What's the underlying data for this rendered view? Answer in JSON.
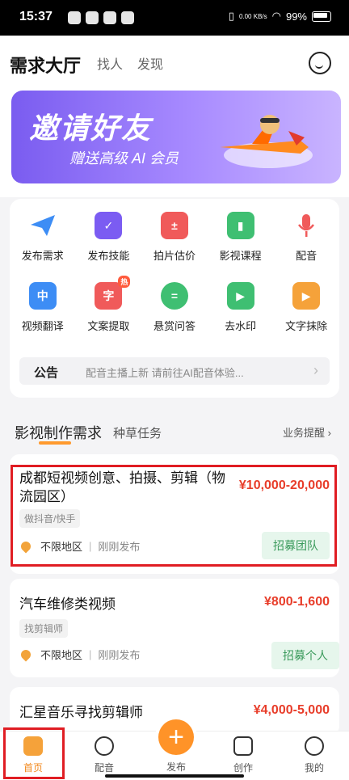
{
  "status": {
    "time": "15:37",
    "speed": "0.00\nKB/s",
    "battery": "99%"
  },
  "header": {
    "tabs": [
      "需求大厅",
      "找人",
      "发现"
    ]
  },
  "banner": {
    "title": "邀请好友",
    "subtitle": "赠送高级 AI 会员"
  },
  "menu": {
    "items": [
      {
        "label": "发布需求",
        "icon": "paper-plane-icon",
        "color": "#3d8df5"
      },
      {
        "label": "发布技能",
        "icon": "check-doc-icon",
        "color": "#7b5cf2"
      },
      {
        "label": "拍片估价",
        "icon": "calculator-icon",
        "color": "#f05a5a"
      },
      {
        "label": "影视课程",
        "icon": "bookmark-icon",
        "color": "#3fbf72"
      },
      {
        "label": "配音",
        "icon": "microphone-icon",
        "color": "#f05a5a"
      },
      {
        "label": "视频翻译",
        "icon": "translate-icon",
        "color": "#3d8df5",
        "glyph": "中"
      },
      {
        "label": "文案提取",
        "icon": "text-extract-icon",
        "color": "#f05a5a",
        "glyph": "字",
        "hot": "热"
      },
      {
        "label": "悬赏问答",
        "icon": "chat-bubble-icon",
        "color": "#3fbf72",
        "glyph": "="
      },
      {
        "label": "去水印",
        "icon": "watermark-icon",
        "color": "#3fbf72",
        "glyph": "▶"
      },
      {
        "label": "文字抹除",
        "icon": "erase-text-icon",
        "color": "#f5a23a",
        "glyph": "▶"
      }
    ],
    "notice_tag": "公告",
    "notice_text": "配音主播上新 请前往AI配音体验..."
  },
  "section": {
    "title": "影视制作需求",
    "sub": "种草任务",
    "right": "业务提醒"
  },
  "cards": [
    {
      "title": "成都短视频创意、拍摄、剪辑（物流园区）",
      "price": "¥10,000-20,000",
      "chip": "做抖音/快手",
      "location": "不限地区",
      "time": "刚刚发布",
      "badge": "招募团队"
    },
    {
      "title": "汽车维修类视频",
      "price": "¥800-1,600",
      "chip": "找剪辑师",
      "location": "不限地区",
      "time": "刚刚发布",
      "badge": "招募个人"
    },
    {
      "title": "汇星音乐寻找剪辑师",
      "price": "¥4,000-5,000"
    }
  ],
  "nav": {
    "items": [
      "首页",
      "配音",
      "发布",
      "创作",
      "我的"
    ]
  }
}
